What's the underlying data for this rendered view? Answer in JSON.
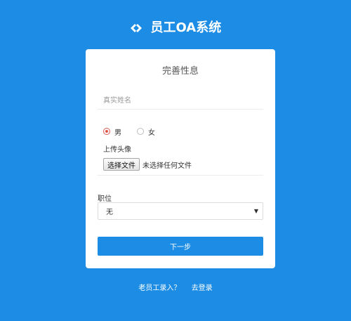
{
  "header": {
    "logo_icon": "diamond-link-logo",
    "title": "员工OA系统"
  },
  "form": {
    "title": "完善性息",
    "name_placeholder": "真实姓名",
    "gender": {
      "options": [
        "男",
        "女"
      ],
      "selected": "男"
    },
    "avatar": {
      "label": "上传头像",
      "choose_button": "选择文件",
      "status": "未选择任何文件"
    },
    "position": {
      "label": "职位",
      "selected": "无",
      "caret_icon": "caret-down-icon"
    },
    "next_button": "下一步"
  },
  "footer": {
    "old_employee_link": "老员工录入？",
    "login_link": "去登录"
  },
  "colors": {
    "background": "#1c8ce4",
    "radio_checked": "#e0584d",
    "button": "#1c8ce4"
  }
}
